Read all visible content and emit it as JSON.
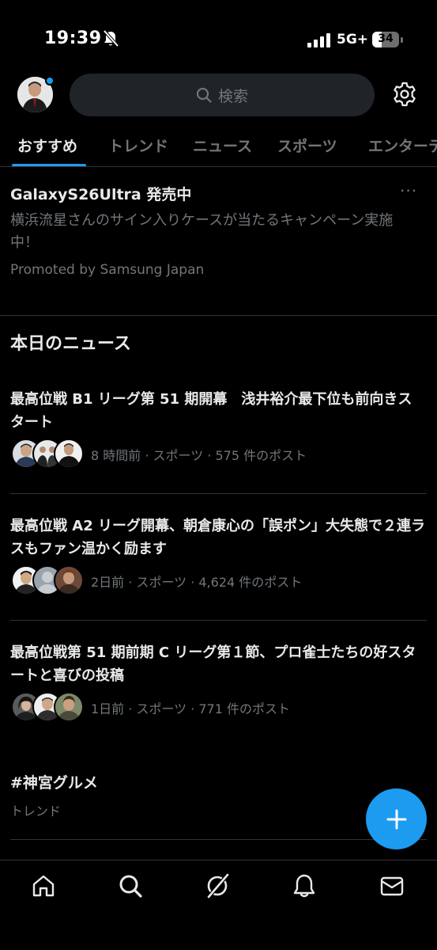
{
  "status_bar": {
    "time": "19:39",
    "network": "5G+",
    "battery_level": "34",
    "battery_fraction": 0.34,
    "icons": [
      "bell-off-icon",
      "signal-icon",
      "battery-icon"
    ]
  },
  "top_bar": {
    "search_placeholder": "検索",
    "icons": [
      "avatar",
      "search-icon",
      "settings-icon"
    ]
  },
  "tabs": [
    {
      "label": "おすすめ",
      "active": true
    },
    {
      "label": "トレンド",
      "active": false
    },
    {
      "label": "ニュース",
      "active": false
    },
    {
      "label": "スポーツ",
      "active": false
    },
    {
      "label": "エンターテ",
      "active": false
    }
  ],
  "promo": {
    "title": "GalaxyS26Ultra 発売中",
    "more": "···",
    "body": "横浜流星さんのサイン入りケースが当たるキャンペーン実施中！",
    "by": "Promoted by Samsung Japan"
  },
  "news_section": {
    "title": "本日のニュース",
    "items": [
      {
        "headline": "最高位戦 B1 リーグ第 51 期開幕　浅井裕介最下位も前向きスタート",
        "meta": "8 時間前 · スポーツ · 575 件のポスト"
      },
      {
        "headline": "最高位戦 A2 リーグ開幕、朝倉康心の「誤ポン」大失態で２連ラスもファン温かく励ます",
        "meta": "2日前 · スポーツ · 4,624 件のポスト"
      },
      {
        "headline": "最高位戦第 51 期前期 C リーグ第１節、プロ雀士たちの好スタートと喜びの投稿",
        "meta": "1日前 · スポーツ · 771 件のポスト"
      }
    ]
  },
  "trend": {
    "title": "#神宮グルメ",
    "subtitle": "トレンド"
  },
  "colors": {
    "background": "#000000",
    "accent": "#1d9bf0",
    "text_primary": "#e7e9ea",
    "text_secondary": "#71767b",
    "divider": "#2f3336",
    "search_bg": "#202327"
  },
  "bottom_nav": [
    "home-icon",
    "search-icon",
    "grok-icon",
    "notifications-icon",
    "messages-icon"
  ]
}
